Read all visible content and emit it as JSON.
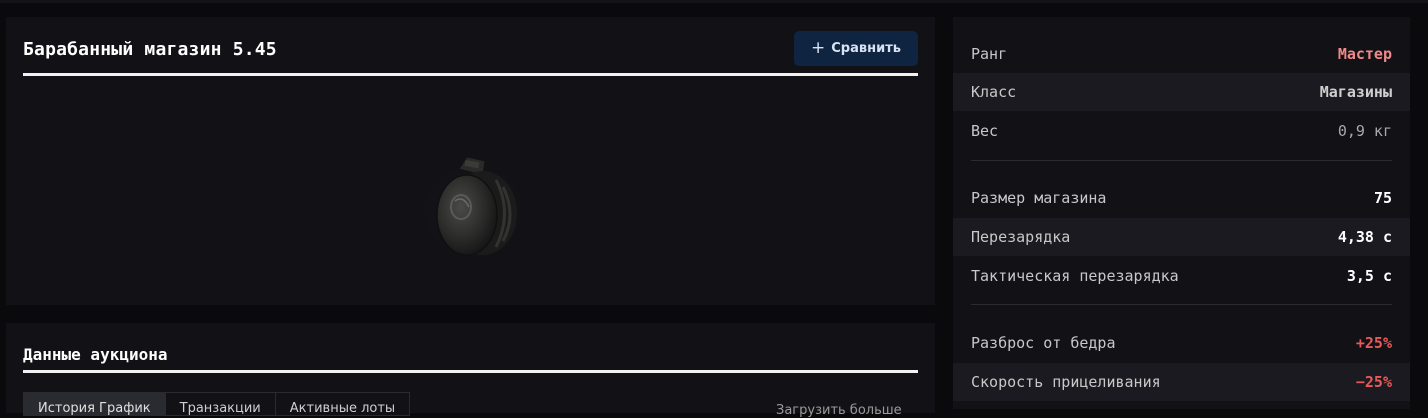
{
  "item": {
    "title": "Барабанный магазин 5.45",
    "compare_label": "Сравнить",
    "compare_icon": "plus-icon",
    "image": "drum-magazine-image"
  },
  "auction": {
    "title": "Данные аукциона",
    "tabs": [
      {
        "label": "История График",
        "active": true
      },
      {
        "label": "Транзакции",
        "active": false
      },
      {
        "label": "Активные лоты",
        "active": false
      }
    ],
    "load_more_label": "Загрузить больше"
  },
  "stats": {
    "group1": [
      {
        "label": "Ранг",
        "value": "Мастер",
        "style": "rank"
      },
      {
        "label": "Класс",
        "value": "Магазины",
        "style": "normal"
      },
      {
        "label": "Вес",
        "value": "0,9 кг",
        "style": "muted"
      }
    ],
    "group2": [
      {
        "label": "Размер магазина",
        "value": "75",
        "style": "normal"
      },
      {
        "label": "Перезарядка",
        "value": "4,38 с",
        "style": "normal"
      },
      {
        "label": "Тактическая перезарядка",
        "value": "3,5 с",
        "style": "normal"
      }
    ],
    "group3": [
      {
        "label": "Разброс от бедра",
        "value": "+25%",
        "style": "bad"
      },
      {
        "label": "Скорость прицеливания",
        "value": "−25%",
        "style": "bad"
      }
    ]
  },
  "colors": {
    "background": "#0a0a0d",
    "card": "#111116",
    "accent_button": "#0f2440",
    "rank": "#f08a8a",
    "negative": "#e85a5a"
  }
}
